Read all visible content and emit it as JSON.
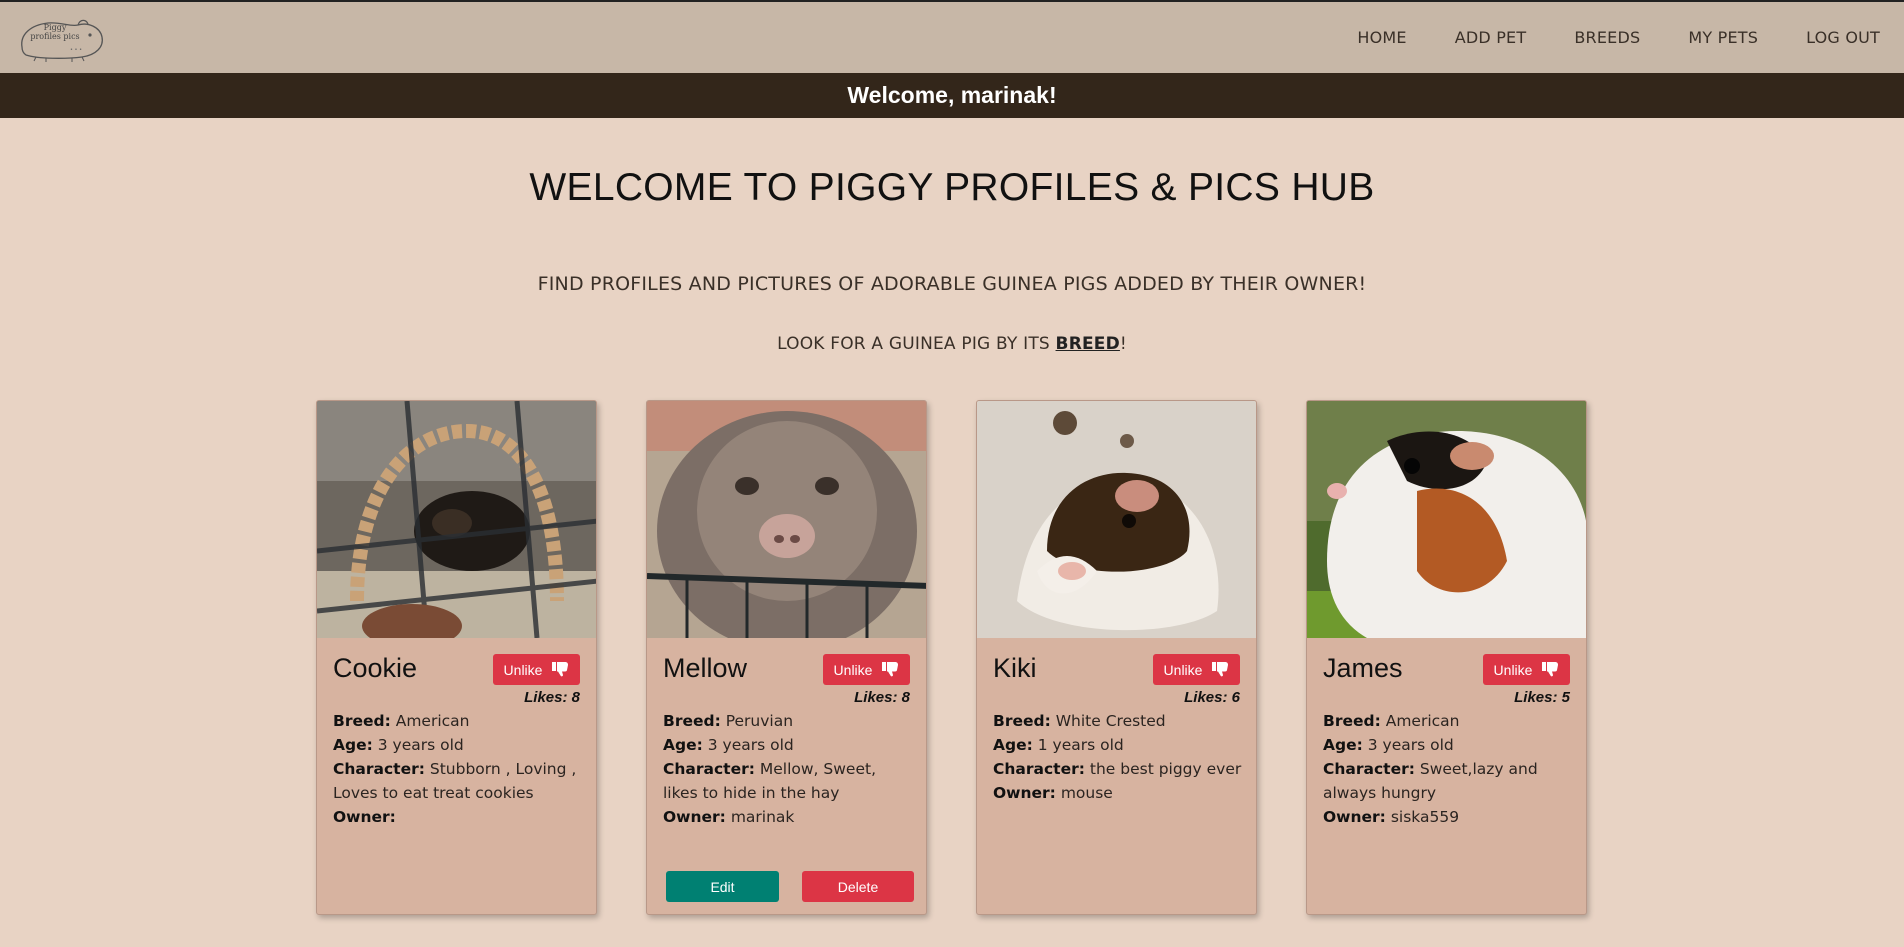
{
  "nav": {
    "logo_text": "Piggy profiles pics",
    "links": [
      "HOME",
      "ADD PET",
      "BREEDS",
      "MY PETS",
      "LOG OUT"
    ]
  },
  "welcome": "Welcome, marinak!",
  "title": "WELCOME TO PIGGY PROFILES & PICS HUB",
  "subtitle": "FIND PROFILES AND PICTURES OF ADORABLE GUINEA PIGS ADDED BY THEIR OWNER!",
  "breed_line": {
    "prefix": "LOOK FOR A GUINEA PIG BY ITS ",
    "link": "BREED",
    "suffix": "!"
  },
  "labels": {
    "breed": "Breed:",
    "age": "Age:",
    "character": "Character:",
    "owner": "Owner:",
    "likes": "Likes:",
    "unlike": "Unlike",
    "edit": "Edit",
    "delete": "Delete"
  },
  "pets": [
    {
      "name": "Cookie",
      "likes": "8",
      "breed": "American",
      "age": "3 years old",
      "character": "Stubborn , Loving , Loves to eat treat cookies",
      "owner": ""
    },
    {
      "name": "Mellow",
      "likes": "8",
      "breed": "Peruvian",
      "age": "3 years old",
      "character": "Mellow, Sweet, likes to hide in the hay",
      "owner": "marinak"
    },
    {
      "name": "Kiki",
      "likes": "6",
      "breed": "White Crested",
      "age": "1 years old",
      "character": "the best piggy ever",
      "owner": "mouse"
    },
    {
      "name": "James",
      "likes": "5",
      "breed": "American",
      "age": "3 years old",
      "character": "Sweet,lazy and always hungry",
      "owner": "siska559"
    }
  ],
  "colors": {
    "background": "#e8d3c4",
    "navbar": "#c7b7a7",
    "welcome_bar": "#33261a",
    "card": "#d7b3a0",
    "danger": "#dc3545",
    "edit": "#008072"
  }
}
